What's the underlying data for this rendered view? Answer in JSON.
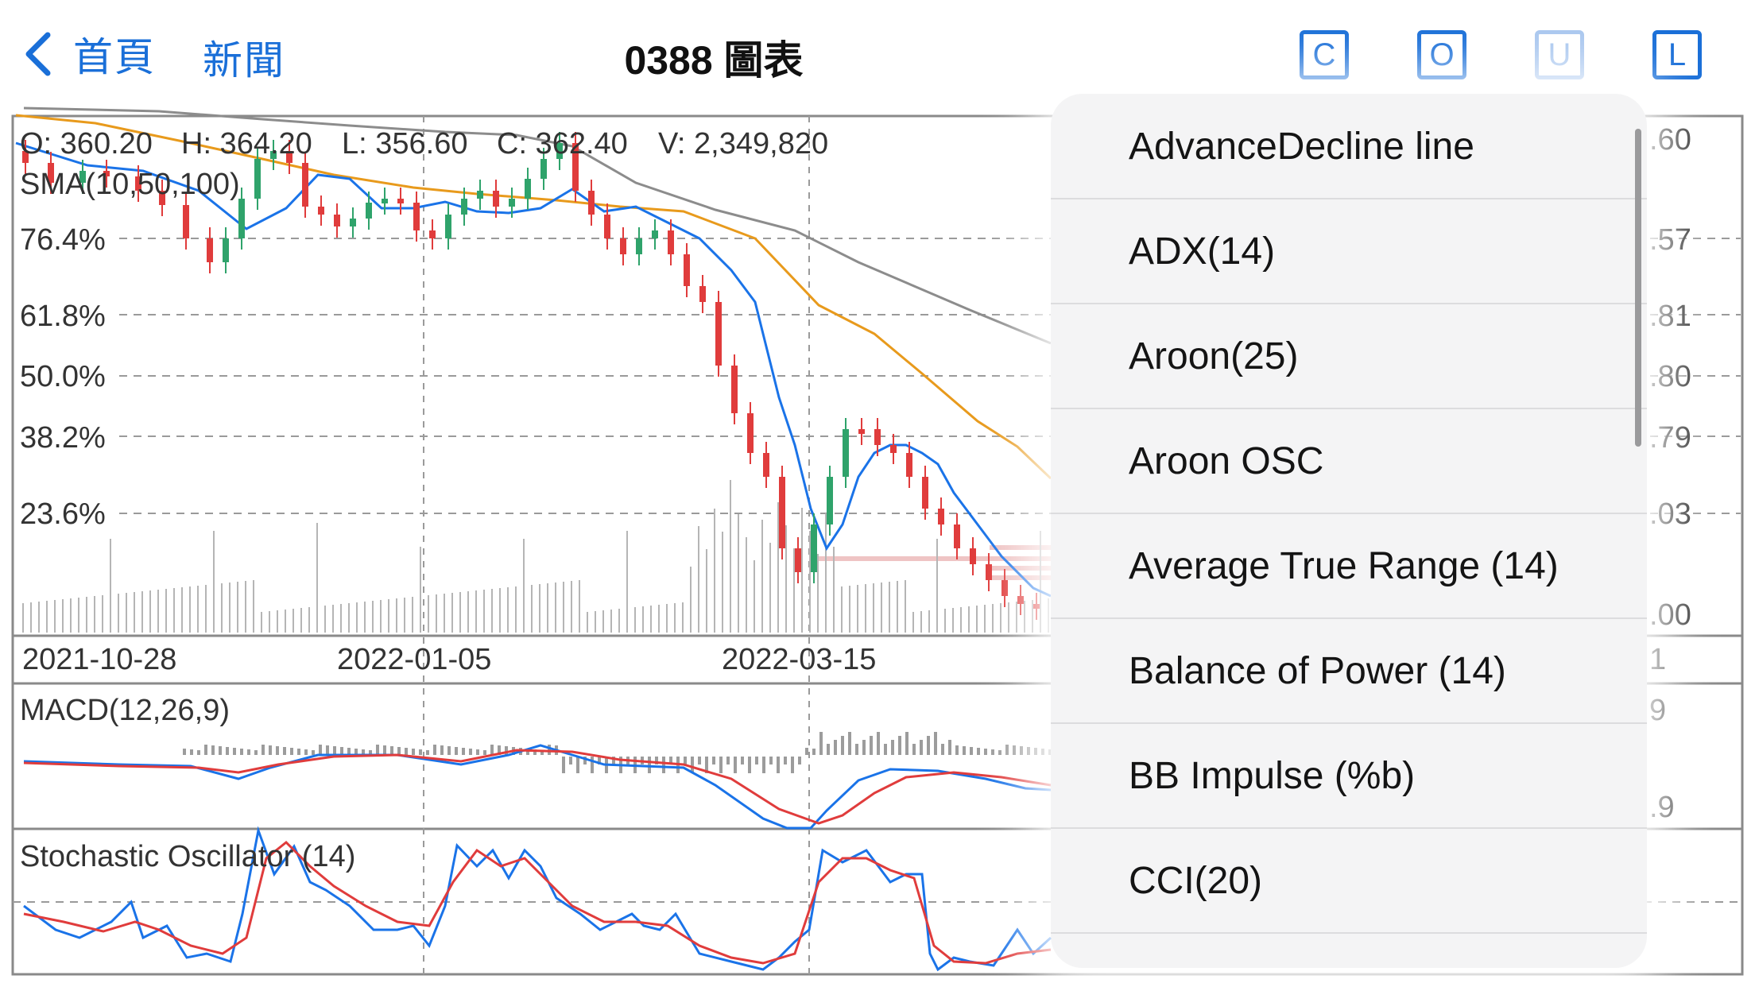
{
  "nav": {
    "back_label": "首頁",
    "news_label": "新聞",
    "title": "0388 圖表",
    "buttons": [
      "C",
      "O",
      "U",
      "L"
    ],
    "accent_color": "#1a6fd8",
    "disabled_color": "#a9c7ef"
  },
  "chart": {
    "ohlcv": {
      "open": "O: 360.20",
      "high": "H: 364.20",
      "low": "L: 356.60",
      "close": "C: 362.40",
      "volume": "V: 2,349,820"
    },
    "sma_label": "SMA(10,50,100)",
    "fib_levels": [
      "76.4%",
      "61.8%",
      "50.0%",
      "38.2%",
      "23.6%"
    ],
    "right_axis_partial": [
      ".60",
      ".57",
      ".81",
      ".80",
      ".79",
      ".03",
      ".00",
      "1",
      "9",
      ".9"
    ],
    "dates": [
      "2021-10-28",
      "2022-01-05",
      "2022-03-15"
    ],
    "macd_label": "MACD(12,26,9)",
    "stoch_label": "Stochastic Oscillator (14)",
    "colors": {
      "up": "#2fa36b",
      "down": "#e03c3c",
      "sma10": "#1a73e8",
      "sma50": "#e89a1c",
      "sma100": "#8c8c8c"
    }
  },
  "chart_data": {
    "type": "candlestick",
    "x": [
      "2021-10-28",
      "2022-01-05",
      "2022-03-15"
    ],
    "price_candles_sample": [
      {
        "label": "last",
        "open": 360.2,
        "high": 364.2,
        "low": 356.6,
        "close": 362.4,
        "volume": 2349820
      }
    ],
    "series": [
      {
        "name": "SMA(10,50,100)"
      },
      {
        "name": "MACD(12,26,9)"
      },
      {
        "name": "Stochastic Oscillator (14)"
      }
    ],
    "fibonacci": [
      "76.4%",
      "61.8%",
      "50.0%",
      "38.2%",
      "23.6%"
    ]
  },
  "indicator_menu": {
    "items": [
      "AdvanceDecline line",
      "ADX(14)",
      "Aroon(25)",
      "Aroon OSC",
      "Average True Range (14)",
      "Balance of Power (14)",
      "BB Impulse (%b)",
      "CCI(20)"
    ]
  }
}
